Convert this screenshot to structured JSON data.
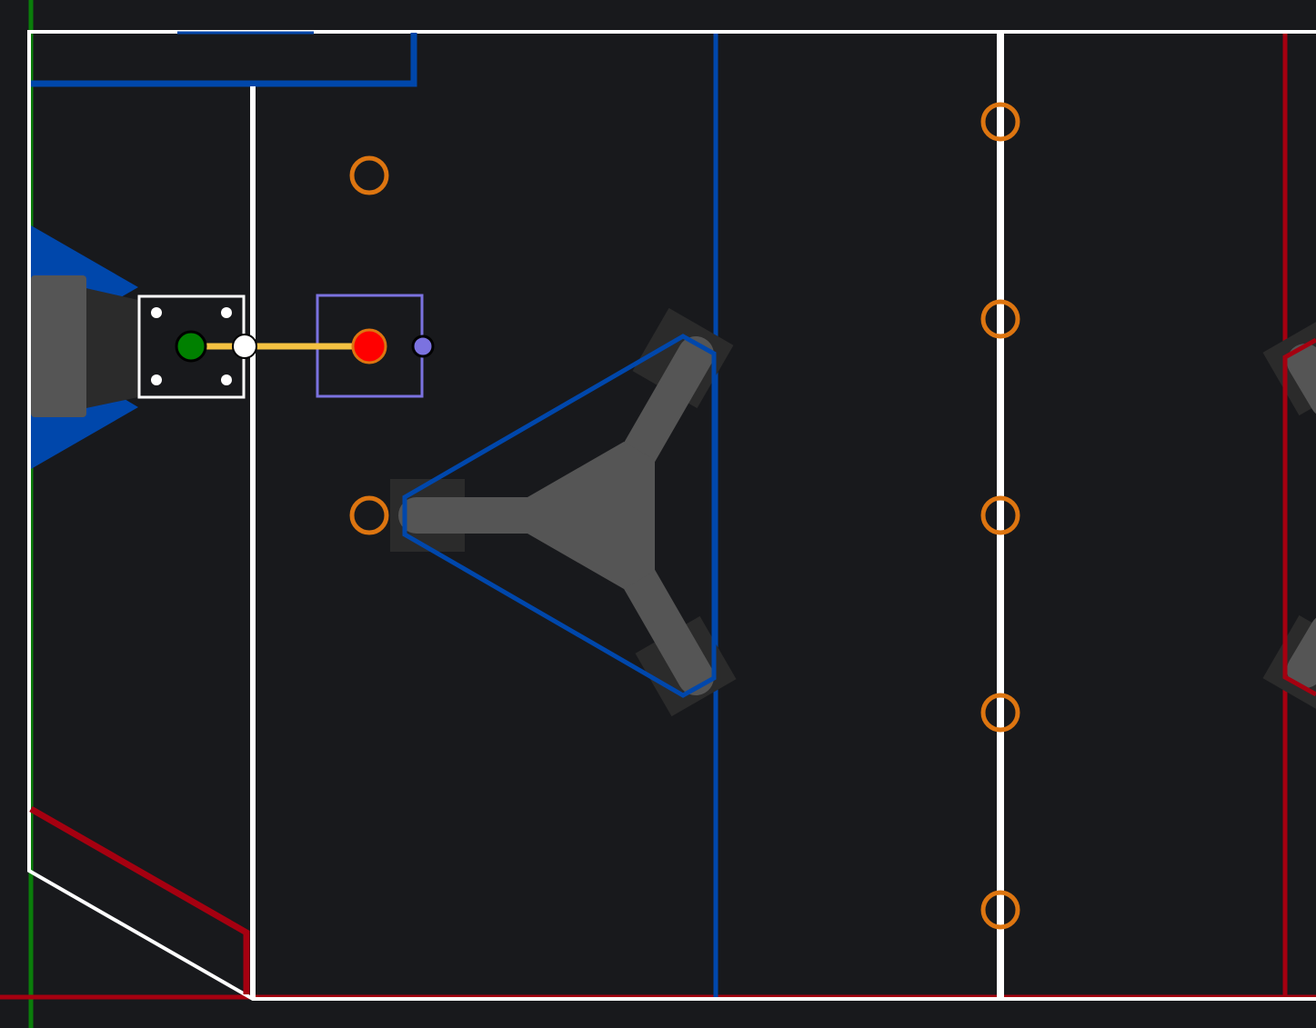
{
  "field_view": {
    "colors": {
      "background": "#18191c",
      "boundary": "#ffffff",
      "blue_alliance": "#0047ab",
      "red_alliance": "#a50010",
      "green_axis": "#0a7d0a",
      "note_ring": "#dd7510",
      "structure_gray": "#555555",
      "structure_dark": "#2b2b2b",
      "path_line": "#f5c242",
      "start_waypoint": "#008000",
      "mid_waypoint": "#ffffff",
      "end_waypoint": "#ff0000",
      "heading_handle": "#7b72e0",
      "selection_box": "#7b72e0"
    },
    "note_rings": {
      "wing_notes": 2,
      "centerline_notes": 5
    },
    "path": {
      "waypoints": [
        "start",
        "mid",
        "end"
      ],
      "heading_handle": "heading"
    }
  }
}
